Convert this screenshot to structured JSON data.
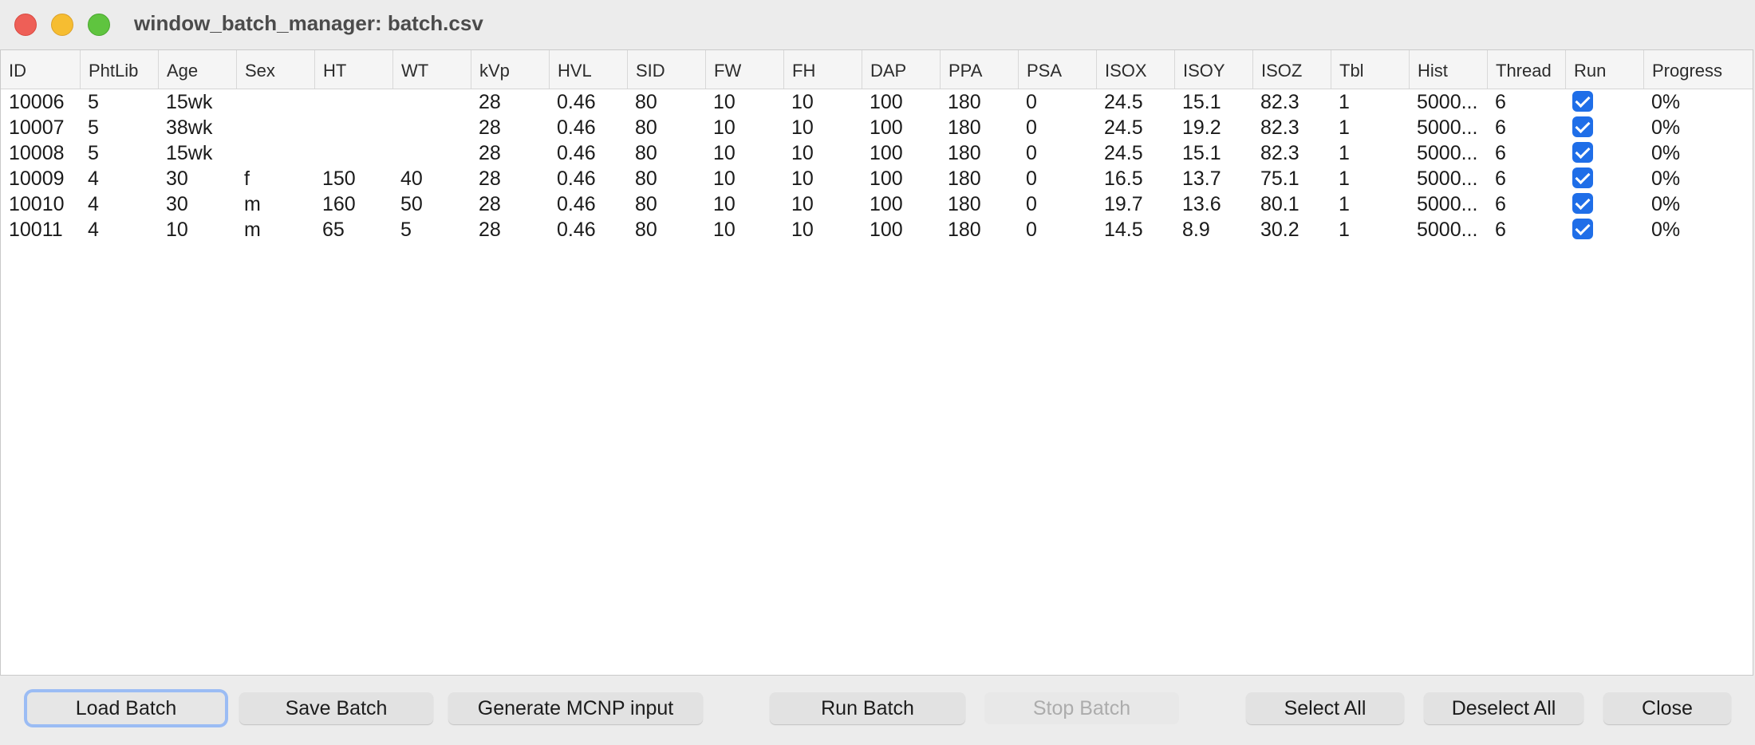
{
  "window": {
    "title": "window_batch_manager: batch.csv"
  },
  "table": {
    "columns": [
      "ID",
      "PhtLib",
      "Age",
      "Sex",
      "HT",
      "WT",
      "kVp",
      "HVL",
      "SID",
      "FW",
      "FH",
      "DAP",
      "PPA",
      "PSA",
      "ISOX",
      "ISOY",
      "ISOZ",
      "Tbl",
      "Hist",
      "Thread",
      "Run",
      "Progress"
    ],
    "rows": [
      [
        "10006",
        "5",
        "15wk",
        "",
        "",
        "",
        "28",
        "0.46",
        "80",
        "10",
        "10",
        "100",
        "180",
        "0",
        "24.5",
        "15.1",
        "82.3",
        "1",
        "5000...",
        "6",
        true,
        "0%"
      ],
      [
        "10007",
        "5",
        "38wk",
        "",
        "",
        "",
        "28",
        "0.46",
        "80",
        "10",
        "10",
        "100",
        "180",
        "0",
        "24.5",
        "19.2",
        "82.3",
        "1",
        "5000...",
        "6",
        true,
        "0%"
      ],
      [
        "10008",
        "5",
        "15wk",
        "",
        "",
        "",
        "28",
        "0.46",
        "80",
        "10",
        "10",
        "100",
        "180",
        "0",
        "24.5",
        "15.1",
        "82.3",
        "1",
        "5000...",
        "6",
        true,
        "0%"
      ],
      [
        "10009",
        "4",
        "30",
        "f",
        "150",
        "40",
        "28",
        "0.46",
        "80",
        "10",
        "10",
        "100",
        "180",
        "0",
        "16.5",
        "13.7",
        "75.1",
        "1",
        "5000...",
        "6",
        true,
        "0%"
      ],
      [
        "10010",
        "4",
        "30",
        "m",
        "160",
        "50",
        "28",
        "0.46",
        "80",
        "10",
        "10",
        "100",
        "180",
        "0",
        "19.7",
        "13.6",
        "80.1",
        "1",
        "5000...",
        "6",
        true,
        "0%"
      ],
      [
        "10011",
        "4",
        "10",
        "m",
        "65",
        "5",
        "28",
        "0.46",
        "80",
        "10",
        "10",
        "100",
        "180",
        "0",
        "14.5",
        "8.9",
        "30.2",
        "1",
        "5000...",
        "6",
        true,
        "0%"
      ]
    ]
  },
  "buttons": {
    "load_batch": "Load Batch",
    "save_batch": "Save Batch",
    "generate_mcnp": "Generate MCNP input",
    "run_batch": "Run Batch",
    "stop_batch": "Stop Batch",
    "select_all": "Select All",
    "deselect_all": "Deselect All",
    "close": "Close"
  },
  "colors": {
    "checkbox": "#1f6ee8",
    "focus_ring": "#9bbcf4"
  }
}
